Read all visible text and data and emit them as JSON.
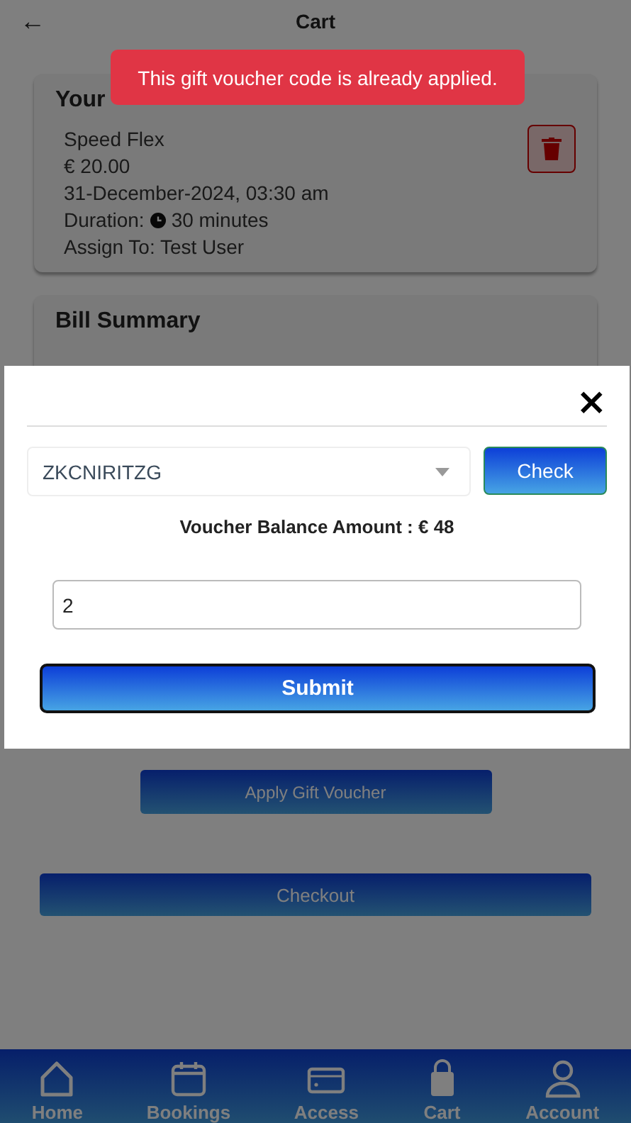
{
  "header": {
    "back": "←",
    "title": "Cart"
  },
  "toast": {
    "message": "This gift voucher code is already applied."
  },
  "order": {
    "title": "Your",
    "product": "Speed Flex",
    "price": "€ 20.00",
    "datetime": "31-December-2024, 03:30 am",
    "duration_label": "Duration:",
    "duration": "30 minutes",
    "assign": "Assign To: Test User"
  },
  "bill": {
    "title": "Bill Summary"
  },
  "buttons": {
    "apply": "Apply Gift Voucher",
    "checkout": "Checkout"
  },
  "modal": {
    "close": "×",
    "voucher_select": "ZKCNIRITZG",
    "check": "Check",
    "balance": "Voucher Balance Amount : € 48",
    "amount_value": "2",
    "submit": "Submit"
  },
  "nav": [
    {
      "label": "Home",
      "kind": "home"
    },
    {
      "label": "Bookings",
      "kind": "calendar"
    },
    {
      "label": "Access",
      "kind": "card"
    },
    {
      "label": "Cart",
      "kind": "bag"
    },
    {
      "label": "Account",
      "kind": "person"
    }
  ]
}
